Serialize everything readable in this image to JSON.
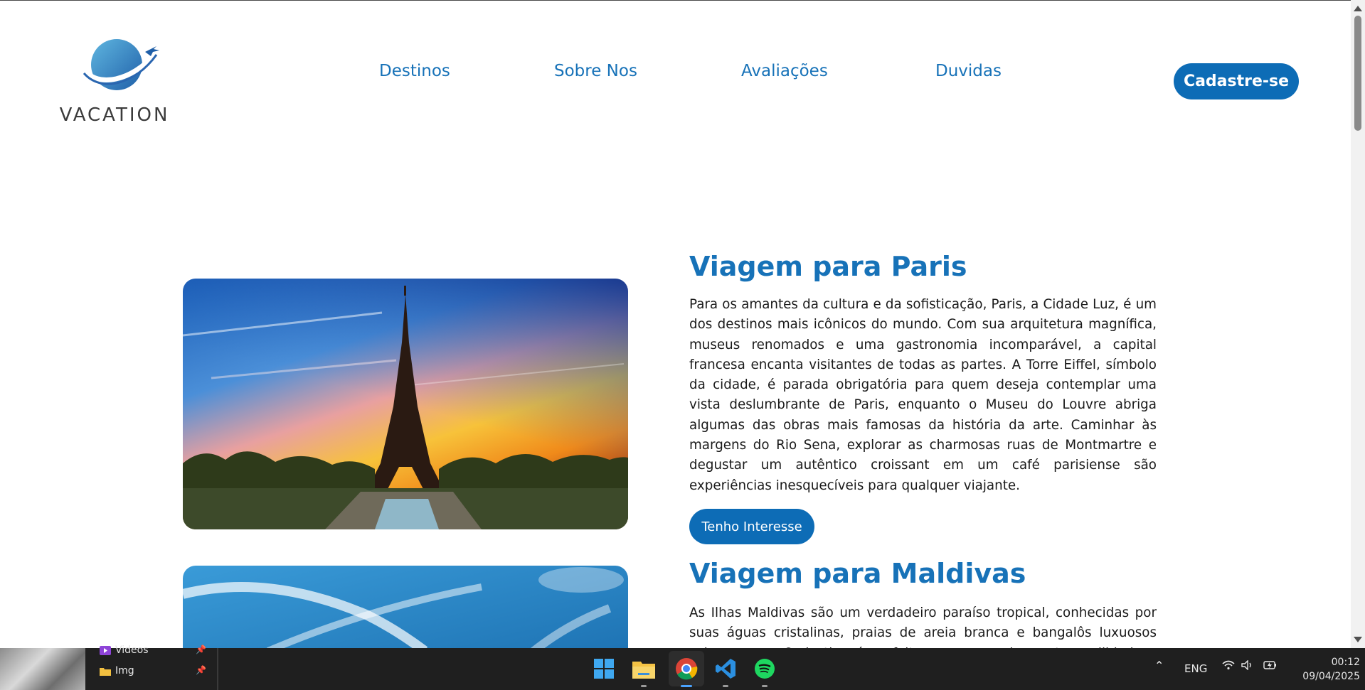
{
  "header": {
    "logo_text": "VACATION",
    "nav": [
      {
        "label": "Destinos"
      },
      {
        "label": "Sobre Nos"
      },
      {
        "label": "Avaliações"
      },
      {
        "label": "Duvidas"
      }
    ],
    "cta_label": "Cadastre-se"
  },
  "sections": [
    {
      "title": "Viagem para Paris",
      "text": "Para os amantes da cultura e da sofisticação, Paris, a Cidade Luz, é um dos destinos mais icônicos do mundo. Com sua arquitetura magnífica, museus renomados e uma gastronomia incomparável, a capital francesa encanta visitantes de todas as partes. A Torre Eiffel, símbolo da cidade, é parada obrigatória para quem deseja contemplar uma vista deslumbrante de Paris, enquanto o Museu do Louvre abriga algumas das obras mais famosas da história da arte. Caminhar às margens do Rio Sena, explorar as charmosas ruas de Montmartre e degustar um autêntico croissant em um café parisiense são experiências inesquecíveis para qualquer viajante.",
      "button": "Tenho Interesse"
    },
    {
      "title": "Viagem para Maldivas",
      "text": "As Ilhas Maldivas são um verdadeiro paraíso tropical, conhecidas por suas águas cristalinas, praias de areia branca e bangalôs luxuosos sobre o mar. O destino é perfeito para quem busca tranquilidade e natureza."
    }
  ],
  "taskbar": {
    "explorer_items": [
      {
        "label": "Videos",
        "icon": "video-folder-icon"
      },
      {
        "label": "Img",
        "icon": "folder-icon"
      }
    ],
    "apps": [
      "windows-start-icon",
      "file-explorer-icon",
      "chrome-icon",
      "vscode-icon",
      "spotify-icon"
    ],
    "language": "ENG",
    "time": "00:12",
    "date": "09/04/2025"
  },
  "colors": {
    "brand_blue": "#1772b8",
    "button_blue": "#0d6cb6",
    "taskbar": "#1f1f1f"
  }
}
